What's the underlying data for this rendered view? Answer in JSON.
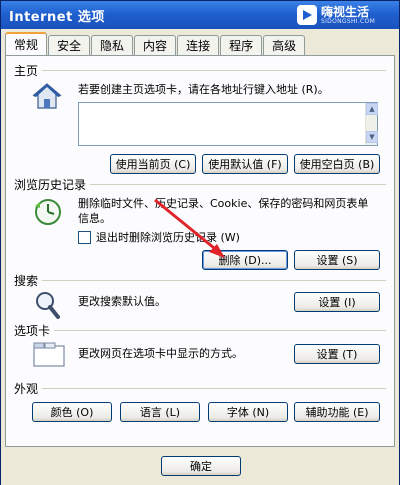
{
  "window": {
    "title": "Internet 选项"
  },
  "watermark": {
    "text": "嗨视生活",
    "sub": "SIDONGSHI.COM"
  },
  "tabs": [
    "常规",
    "安全",
    "隐私",
    "内容",
    "连接",
    "程序",
    "高级"
  ],
  "home": {
    "label": "主页",
    "description": "若要创建主页选项卡，请在各地址行键入地址 (R)。",
    "address_value": "",
    "buttons": {
      "current": "使用当前页 (C)",
      "default": "使用默认值 (F)",
      "blank": "使用空白页 (B)"
    }
  },
  "history": {
    "label": "浏览历史记录",
    "description": "删除临时文件、历史记录、Cookie、保存的密码和网页表单信息。",
    "checkbox_label": "退出时删除浏览历史记录 (W)",
    "buttons": {
      "delete": "删除 (D)...",
      "settings": "设置 (S)"
    }
  },
  "search": {
    "label": "搜索",
    "description": "更改搜索默认值。",
    "buttons": {
      "settings": "设置 (I)"
    }
  },
  "tabs_section": {
    "label": "选项卡",
    "description": "更改网页在选项卡中显示的方式。",
    "buttons": {
      "settings": "设置 (T)"
    }
  },
  "appearance": {
    "label": "外观",
    "buttons": {
      "colors": "颜色 (O)",
      "languages": "语言 (L)",
      "fonts": "字体 (N)",
      "accessibility": "辅助功能 (E)"
    }
  },
  "footer": {
    "ok": "确定"
  },
  "colors": {
    "title_bar": "#1f5fcf",
    "annotation_arrow": "#e0242a"
  }
}
